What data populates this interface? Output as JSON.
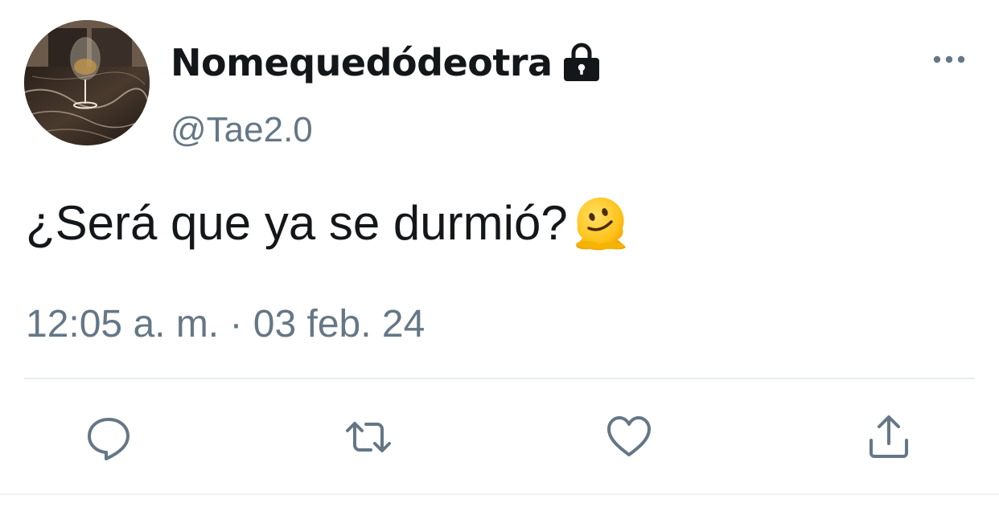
{
  "author": {
    "display_name": "Nomequedódeotra",
    "handle": "@Tae2.0",
    "protected_icon": "lock-icon",
    "avatar": "avatar-wine-glass-photo"
  },
  "tweet": {
    "text": "¿Será que ya se durmió?",
    "emoji": "melting-face-emoji",
    "timestamp": "12:05 a. m. · 03 feb. 24"
  },
  "menu": {
    "icon": "more-icon"
  },
  "actions": [
    {
      "name": "reply",
      "icon": "reply-icon"
    },
    {
      "name": "retweet",
      "icon": "retweet-icon"
    },
    {
      "name": "like",
      "icon": "heart-icon"
    },
    {
      "name": "share",
      "icon": "share-icon"
    }
  ],
  "colors": {
    "text_primary": "#14171a",
    "text_secondary": "#657786",
    "divider": "#e6ecf0",
    "icon": "#657786"
  }
}
